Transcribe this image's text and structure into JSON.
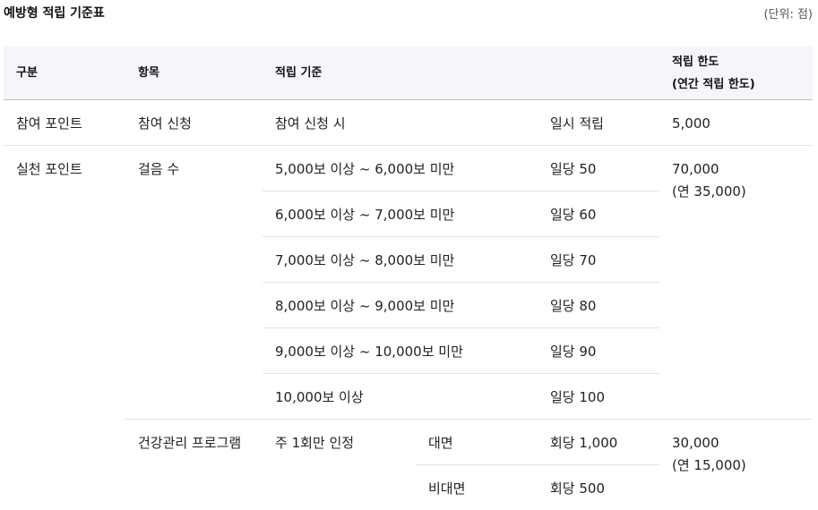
{
  "title": "예방형 적립 기준표",
  "unit_note": "(단위: 점)",
  "headers": {
    "category": "구분",
    "item": "항목",
    "criteria": "적립 기준",
    "limit_line1": "적립 한도",
    "limit_line2": "(연간 적립 한도)"
  },
  "rows": {
    "participation": {
      "category": "참여 포인트",
      "item": "참여 신청",
      "criteria": "참여 신청 시",
      "points": "일시 적립",
      "limit": "5,000"
    },
    "practice": {
      "category": "실천 포인트",
      "steps": {
        "item": "걸음 수",
        "limit_line1": "70,000",
        "limit_line2": "(연 35,000)",
        "levels": [
          {
            "criteria": "5,000보 이상 ~ 6,000보 미만",
            "points": "일당 50"
          },
          {
            "criteria": "6,000보 이상 ~ 7,000보 미만",
            "points": "일당 60"
          },
          {
            "criteria": "7,000보 이상 ~ 8,000보 미만",
            "points": "일당 70"
          },
          {
            "criteria": "8,000보 이상 ~ 9,000보 미만",
            "points": "일당 80"
          },
          {
            "criteria": "9,000보 이상 ~ 10,000보 미만",
            "points": "일당 90"
          },
          {
            "criteria": "10,000보 이상",
            "points": "일당 100"
          }
        ]
      },
      "program": {
        "item": "건강관리 프로그램",
        "criteria": "주 1회만 인정",
        "limit_line1": "30,000",
        "limit_line2": "(연 15,000)",
        "modes": [
          {
            "mode": "대면",
            "points": "회당 1,000"
          },
          {
            "mode": "비대면",
            "points": "회당 500"
          }
        ]
      }
    }
  }
}
